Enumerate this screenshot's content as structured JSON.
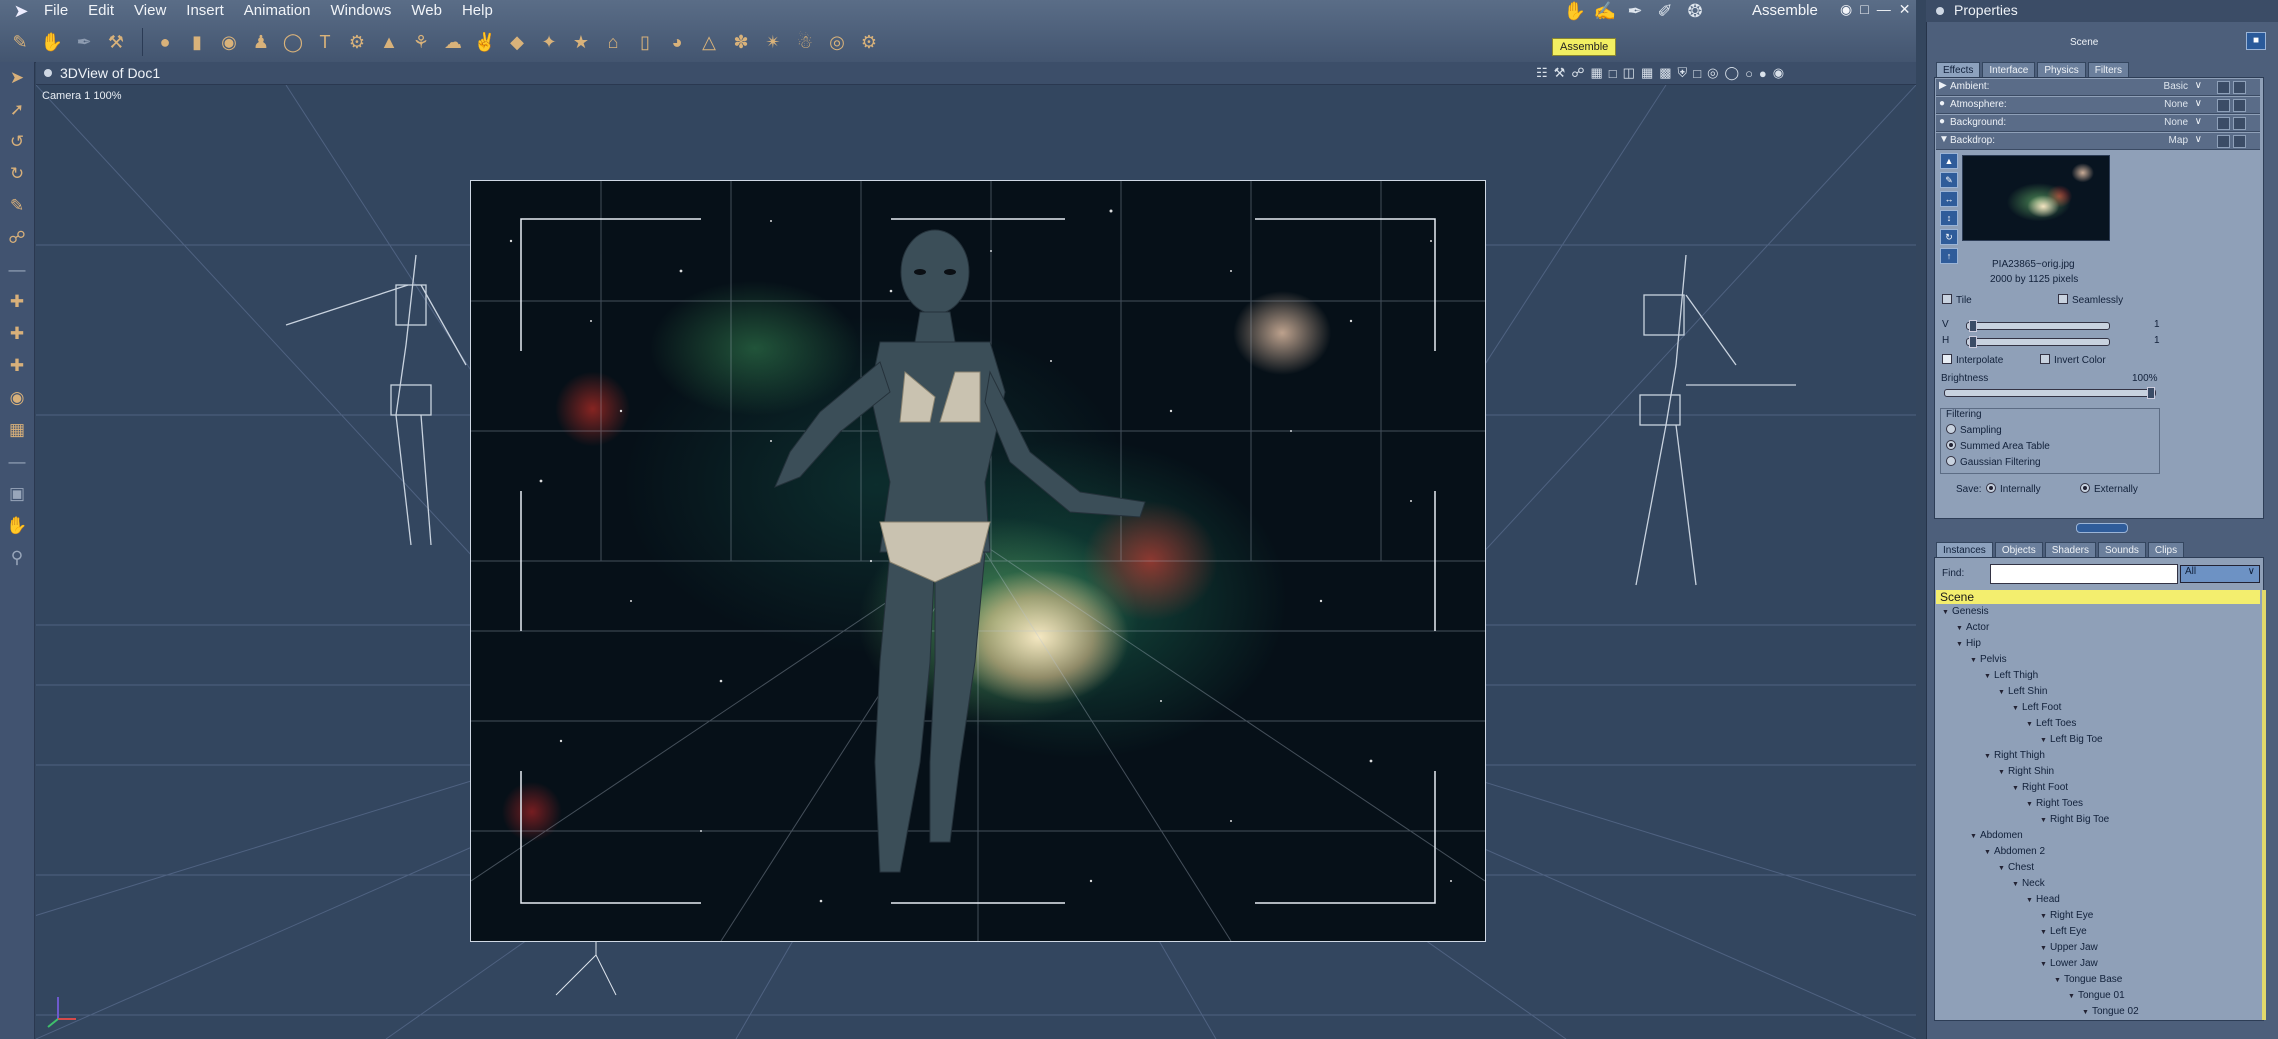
{
  "menubar": {
    "items": [
      "File",
      "Edit",
      "View",
      "Insert",
      "Animation",
      "Windows",
      "Web",
      "Help"
    ]
  },
  "room": {
    "label": "Assemble",
    "tooltip": "Assemble"
  },
  "viewport": {
    "title": "3DView of Doc1",
    "camera": "Camera 1 100%"
  },
  "properties": {
    "title": "Properties",
    "scene_label": "Scene",
    "tabs": [
      "Effects",
      "Interface",
      "Physics",
      "Filters"
    ],
    "rows": [
      {
        "label": "Ambient:",
        "value": "Basic"
      },
      {
        "label": "Atmosphere:",
        "value": "None"
      },
      {
        "label": "Background:",
        "value": "None"
      },
      {
        "label": "Backdrop:",
        "value": "Map"
      }
    ],
    "filename": "PIA23865~orig.jpg",
    "dimensions": "2000 by 1125 pixels",
    "tile": "Tile",
    "seamlessly": "Seamlessly",
    "v_label": "V",
    "v_value": "1",
    "h_label": "H",
    "h_value": "1",
    "interpolate": "Interpolate",
    "invert_color": "Invert Color",
    "brightness_label": "Brightness",
    "brightness_value": "100%",
    "filtering_label": "Filtering",
    "filtering_options": [
      "Sampling",
      "Summed Area Table",
      "Gaussian Filtering"
    ],
    "save_label": "Save:",
    "save_internally": "Internally",
    "save_externally": "Externally"
  },
  "instances": {
    "tabs": [
      "Instances",
      "Objects",
      "Shaders",
      "Sounds",
      "Clips"
    ],
    "find_label": "Find:",
    "find_value": "",
    "filter_value": "All",
    "scene_header": "Scene",
    "tree": [
      {
        "label": "Genesis",
        "depth": 0
      },
      {
        "label": "Actor",
        "depth": 1
      },
      {
        "label": "Hip",
        "depth": 1
      },
      {
        "label": "Pelvis",
        "depth": 2
      },
      {
        "label": "Left Thigh",
        "depth": 3
      },
      {
        "label": "Left Shin",
        "depth": 4
      },
      {
        "label": "Left Foot",
        "depth": 5
      },
      {
        "label": "Left Toes",
        "depth": 6
      },
      {
        "label": "Left Big Toe",
        "depth": 7
      },
      {
        "label": "Right Thigh",
        "depth": 3
      },
      {
        "label": "Right Shin",
        "depth": 4
      },
      {
        "label": "Right Foot",
        "depth": 5
      },
      {
        "label": "Right Toes",
        "depth": 6
      },
      {
        "label": "Right Big Toe",
        "depth": 7
      },
      {
        "label": "Abdomen",
        "depth": 2
      },
      {
        "label": "Abdomen 2",
        "depth": 3
      },
      {
        "label": "Chest",
        "depth": 4
      },
      {
        "label": "Neck",
        "depth": 5
      },
      {
        "label": "Head",
        "depth": 6
      },
      {
        "label": "Right Eye",
        "depth": 7
      },
      {
        "label": "Left Eye",
        "depth": 7
      },
      {
        "label": "Upper Jaw",
        "depth": 7
      },
      {
        "label": "Lower Jaw",
        "depth": 7
      },
      {
        "label": "Tongue Base",
        "depth": 8
      },
      {
        "label": "Tongue 01",
        "depth": 9
      },
      {
        "label": "Tongue 02",
        "depth": 10
      }
    ]
  },
  "colors": {
    "accent": "#f3ee6e",
    "panel": "#8fa0b8",
    "viewport": "#33465f"
  }
}
